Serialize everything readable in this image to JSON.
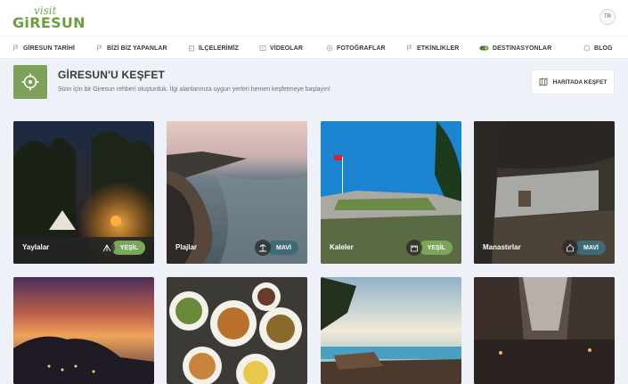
{
  "logo": {
    "script": "visit",
    "main": "GiRESUN"
  },
  "header": {
    "lang": "TR"
  },
  "nav": {
    "items": [
      {
        "label": "GİRESUN TARİHİ",
        "icon": "flag-icon"
      },
      {
        "label": "BİZİ BİZ YAPANLAR",
        "icon": "flag-icon"
      },
      {
        "label": "İLÇELERİMİZ",
        "icon": "building-icon"
      },
      {
        "label": "VİDEOLAR",
        "icon": "video-icon"
      },
      {
        "label": "FOTOĞRAFLAR",
        "icon": "camera-icon"
      },
      {
        "label": "ETKİNLİKLER",
        "icon": "flag-icon"
      },
      {
        "label": "DESTİNASYONLAR",
        "icon": "toggle-icon"
      },
      {
        "label": "BLOG",
        "icon": "chat-icon"
      }
    ]
  },
  "section": {
    "title": "GİRESUN'U KEŞFET",
    "subtitle": "Sizin için bir Giresun rehberi oluşturduk. İlgi alanlarınıza uygun yerleri hemen keşfetmeye başlayın!",
    "map_button": "HARİTADA KEŞFET",
    "icon": "compass-icon"
  },
  "cards": [
    {
      "label": "Yaylalar",
      "badge": "YEŞİL",
      "badge_color": "#7ca65a",
      "icon": "tent-icon"
    },
    {
      "label": "Plajlar",
      "badge": "MAVİ",
      "badge_color": "#3f6a78",
      "icon": "beach-icon"
    },
    {
      "label": "Kaleler",
      "badge": "YEŞİL",
      "badge_color": "#7ca65a",
      "icon": "castle-icon"
    },
    {
      "label": "Manastırlar",
      "badge": "MAVİ",
      "badge_color": "#3f6a78",
      "icon": "monastery-icon"
    },
    {
      "label": "",
      "badge": "",
      "icon": ""
    },
    {
      "label": "",
      "badge": "",
      "icon": ""
    },
    {
      "label": "",
      "badge": "",
      "icon": ""
    },
    {
      "label": "",
      "badge": "",
      "icon": ""
    }
  ]
}
